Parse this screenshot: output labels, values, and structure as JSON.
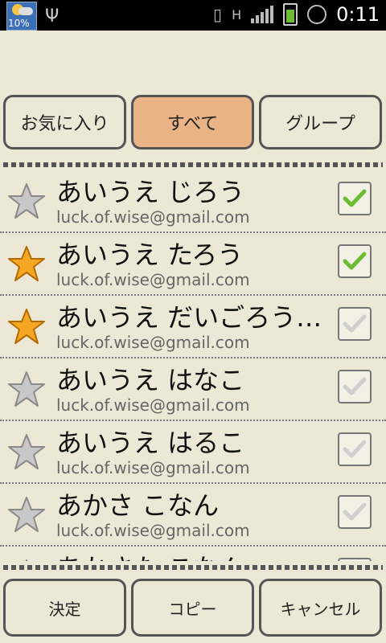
{
  "statusbar": {
    "weather_pct": "10%",
    "network_label": "H",
    "time": "0:11"
  },
  "tabs": [
    {
      "label": "お気に入り",
      "active": false
    },
    {
      "label": "すべて",
      "active": true
    },
    {
      "label": "グループ",
      "active": false
    }
  ],
  "contacts": [
    {
      "name": "あいうえ じろう",
      "email": "luck.of.wise@gmail.com",
      "favorite": false,
      "checked": true
    },
    {
      "name": "あいうえ たろう",
      "email": "luck.of.wise@gmail.com",
      "favorite": true,
      "checked": true
    },
    {
      "name": "あいうえ だいごろう…",
      "email": "luck.of.wise@gmail.com",
      "favorite": true,
      "checked": false
    },
    {
      "name": "あいうえ はなこ",
      "email": "luck.of.wise@gmail.com",
      "favorite": false,
      "checked": false
    },
    {
      "name": "あいうえ はるこ",
      "email": "luck.of.wise@gmail.com",
      "favorite": false,
      "checked": false
    },
    {
      "name": "あかさ こなん",
      "email": "luck.of.wise@gmail.com",
      "favorite": false,
      "checked": false
    },
    {
      "name": "あかさた こなん",
      "email": "",
      "favorite": false,
      "checked": false
    }
  ],
  "buttons": {
    "ok": "決定",
    "copy": "コピー",
    "cancel": "キャンセル"
  },
  "colors": {
    "background": "#ede7d5",
    "active_tab": "#e9b385",
    "check_on": "#6cbc34",
    "check_off": "#cfcfcf",
    "star_on": "#f5a623",
    "star_off": "#c8c8c8"
  }
}
